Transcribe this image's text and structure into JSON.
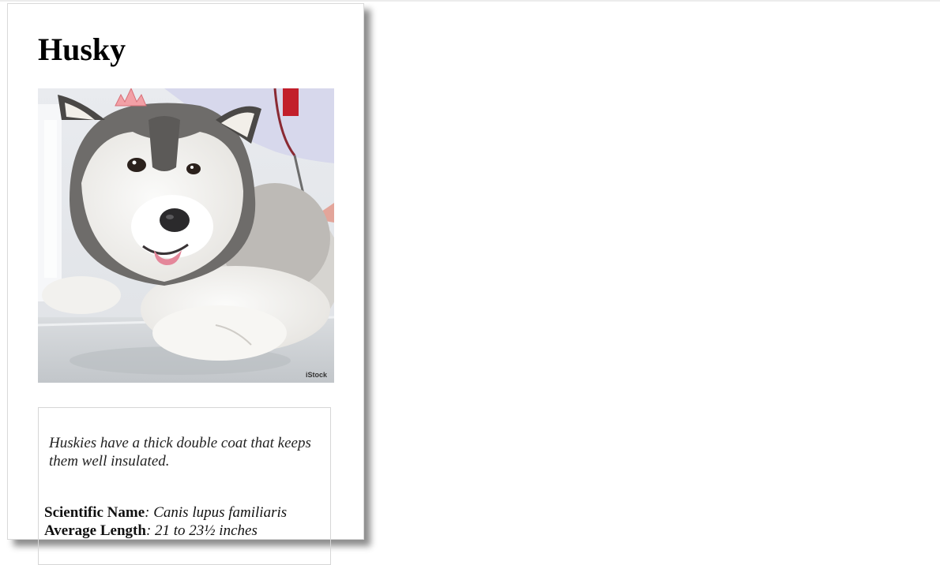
{
  "card": {
    "title": "Husky",
    "image": {
      "alt": "Husky dog lying on a veterinary exam table",
      "watermark": "iStock"
    },
    "fact": "Huskies have a thick double coat that keeps them well insulated.",
    "details": [
      {
        "label": "Scientific Name",
        "value": ": Canis lupus familiaris"
      },
      {
        "label": "Average Length",
        "value": ": 21 to 23½ inches"
      }
    ]
  },
  "colors": {
    "border": "#d9d9d9",
    "text": "#000000",
    "shadow": "#737373"
  }
}
